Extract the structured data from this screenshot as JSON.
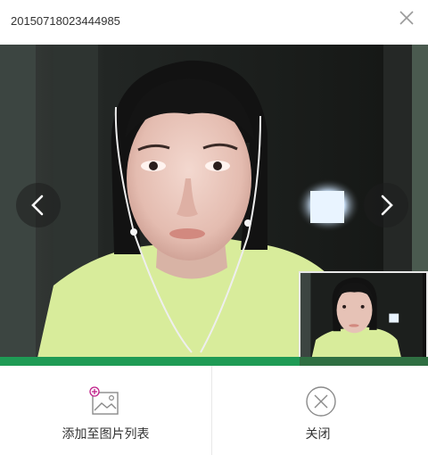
{
  "window": {
    "title": "20150718023444985"
  },
  "viewer": {
    "progress": 0.7
  },
  "actions": {
    "add_label": "添加至图片列表",
    "close_label": "关闭"
  },
  "colors": {
    "accent_green": "#1f9b55",
    "add_icon_plus": "#c0208a"
  },
  "icons": {
    "window_close": "close-icon",
    "prev": "chevron-left-icon",
    "next": "chevron-right-icon",
    "add": "add-image-icon",
    "close": "circle-x-icon"
  }
}
